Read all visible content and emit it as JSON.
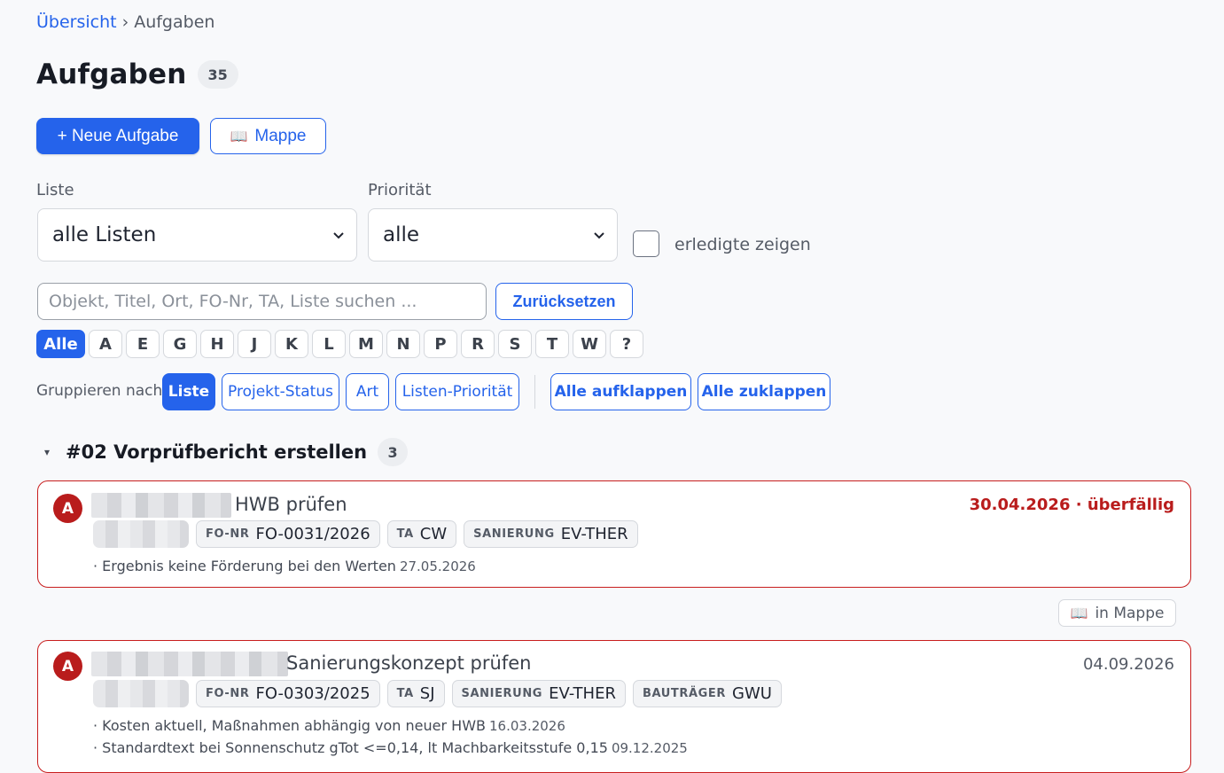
{
  "breadcrumb": {
    "parent": "Übersicht",
    "separator": "›",
    "current": "Aufgaben"
  },
  "page": {
    "title": "Aufgaben",
    "count": "35"
  },
  "toolbar": {
    "new_task": "+ Neue Aufgabe",
    "folder": "Mappe",
    "folder_icon": "📖"
  },
  "filters": {
    "list_label": "Liste",
    "list_value": "alle Listen",
    "priority_label": "Priorität",
    "priority_value": "alle",
    "show_done_label": "erledigte zeigen",
    "show_done_checked": false
  },
  "search": {
    "placeholder": "Objekt, Titel, Ort, FO-Nr, TA, Liste suchen ...",
    "value": "",
    "reset": "Zurücksetzen"
  },
  "letters": [
    "Alle",
    "A",
    "E",
    "G",
    "H",
    "J",
    "K",
    "L",
    "M",
    "N",
    "P",
    "R",
    "S",
    "T",
    "W",
    "?"
  ],
  "grouping": {
    "label": "Gruppieren nach",
    "options": [
      "Liste",
      "Projekt-Status",
      "Art",
      "Listen-Priorität"
    ],
    "active": "Liste",
    "expand_all": "Alle aufklappen",
    "collapse_all": "Alle zuklappen"
  },
  "group": {
    "toggle": "▾",
    "title": "#02 Vorprüfbericht erstellen",
    "count": "3"
  },
  "tasks": [
    {
      "priority": "A",
      "title": "HWB prüfen",
      "due": "30.04.2026 · überfällig",
      "tags": [
        {
          "key": "FO-NR",
          "value": "FO-0031/2026"
        },
        {
          "key": "TA",
          "value": "CW"
        },
        {
          "key": "SANIERUNG",
          "value": "EV-THER"
        }
      ],
      "notes": [
        {
          "text": "· Ergebnis keine Förderung bei den Werten",
          "date": "27.05.2026"
        }
      ],
      "mappe": "in Mappe"
    },
    {
      "priority": "A",
      "title": "Sanierungskonzept prüfen",
      "due": "04.09.2026",
      "tags": [
        {
          "key": "FO-NR",
          "value": "FO-0303/2025"
        },
        {
          "key": "TA",
          "value": "SJ"
        },
        {
          "key": "SANIERUNG",
          "value": "EV-THER"
        },
        {
          "key": "BAUTRÄGER",
          "value": "GWU"
        }
      ],
      "notes": [
        {
          "text": "· Kosten aktuell, Maßnahmen abhängig von neuer HWB",
          "date": "16.03.2026"
        },
        {
          "text": "· Standardtext bei Sonnenschutz gTot <=0,14, lt Machbarkeitsstufe 0,15",
          "date": "09.12.2025"
        }
      ]
    }
  ],
  "colors": {
    "accent": "#2563eb",
    "danger": "#b91c1c"
  }
}
